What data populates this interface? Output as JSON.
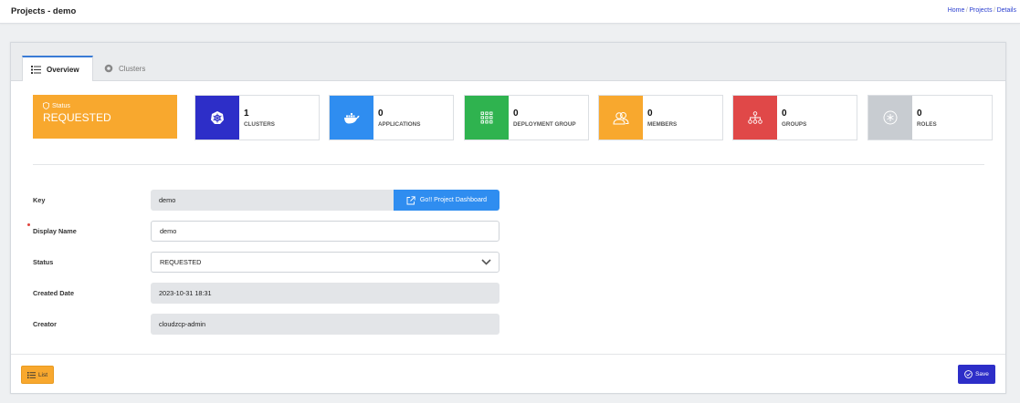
{
  "header": {
    "title": "Projects - demo",
    "breadcrumb": [
      "Home",
      "Projects",
      "Details"
    ]
  },
  "tabs": [
    {
      "label": "Overview",
      "icon": "list-icon",
      "active": true
    },
    {
      "label": "Clusters",
      "icon": "cluster-icon",
      "active": false
    }
  ],
  "status_box": {
    "label": "Status",
    "value": "REQUESTED",
    "color": "#f8a82e"
  },
  "stats": [
    {
      "value": "1",
      "label": "CLUSTERS",
      "icon": "kubernetes-icon",
      "color": "#2d2ec8"
    },
    {
      "value": "0",
      "label": "APPLICATIONS",
      "icon": "docker-icon",
      "color": "#2f8df0"
    },
    {
      "value": "0",
      "label": "DEPLOYMENT GROUP",
      "icon": "grid-icon",
      "color": "#2fb34f"
    },
    {
      "value": "0",
      "label": "MEMBERS",
      "icon": "users-icon",
      "color": "#f8a82e"
    },
    {
      "value": "0",
      "label": "GROUPS",
      "icon": "sitemap-icon",
      "color": "#e04848"
    },
    {
      "value": "0",
      "label": "ROLES",
      "icon": "asterisk-icon",
      "color": "#c8ccd1"
    }
  ],
  "form": {
    "key_label": "Key",
    "key_value": "demo",
    "dashboard_button": "Go!! Project Dashboard",
    "display_name_label": "Display Name",
    "display_name_value": "demo",
    "status_label": "Status",
    "status_value": "REQUESTED",
    "created_label": "Created Date",
    "created_value": "2023-10-31 18:31",
    "creator_label": "Creator",
    "creator_value": "cloudzcp-admin"
  },
  "footer": {
    "list_button": "List",
    "save_button": "Save"
  }
}
